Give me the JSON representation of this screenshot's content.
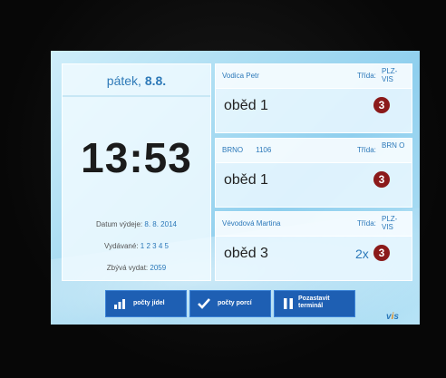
{
  "left": {
    "day_name": "pátek,",
    "day_date": "8.8.",
    "time": "13:53",
    "issue_date_label": "Datum výdeje:",
    "issue_date_value": "8. 8. 2014",
    "issued_label": "Vydávané:",
    "issued_value": "1 2 3 4 5",
    "remaining_label": "Zbývá vydat:",
    "remaining_value": "2059"
  },
  "orders": [
    {
      "name": "Vodica Petr",
      "number": "",
      "class_label": "Třída:",
      "class_value": "PLZ-VIS",
      "meal": "oběd 1",
      "qty": "",
      "badge": "3"
    },
    {
      "name": "BRNO",
      "number": "1106",
      "class_label": "Třída:",
      "class_value": "BRN O",
      "meal": "oběd 1",
      "qty": "",
      "badge": "3"
    },
    {
      "name": "Vévodová Martina",
      "number": "",
      "class_label": "Třída:",
      "class_value": "PLZ-VIS",
      "meal": "oběd 3",
      "qty": "2x",
      "badge": "3"
    }
  ],
  "buttons": {
    "meal_counts": "počty jídel",
    "portion_counts": "počty porcí",
    "pause_line1": "Pozastavit",
    "pause_line2": "terminál"
  },
  "icons": [
    "bar-chart-icon",
    "checkmark-icon",
    "pause-icon"
  ],
  "colors": {
    "accent": "#2b78b9",
    "button": "#1e5fb3",
    "badge": "#8b1a1a"
  }
}
